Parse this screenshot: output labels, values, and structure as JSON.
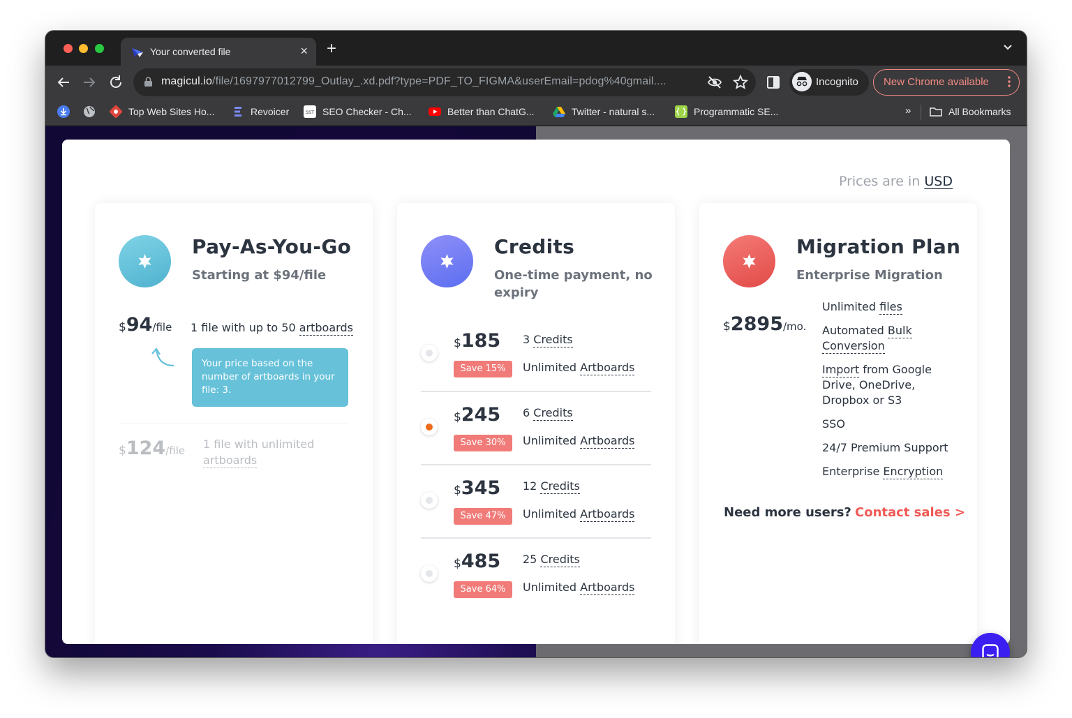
{
  "browser": {
    "tab_title": "Your converted file",
    "new_tab_label": "+",
    "url_host": "magicul.io",
    "url_path": "/file/1697977012799_Outlay_.xd.pdf?type=PDF_TO_FIGMA&userEmail=pdog%40gmail....",
    "incognito_label": "Incognito",
    "update_label": "New Chrome available",
    "bookmarks": [
      {
        "label": ""
      },
      {
        "label": ""
      },
      {
        "label": "Top Web Sites Ho..."
      },
      {
        "label": "Revoicer"
      },
      {
        "label": "SEO Checker - Ch..."
      },
      {
        "label": "Better than ChatG..."
      },
      {
        "label": "Twitter - natural s..."
      },
      {
        "label": "Programmatic SE..."
      }
    ],
    "bookmarks_overflow": "»",
    "all_bookmarks_label": "All Bookmarks"
  },
  "pricing": {
    "currency_prefix": "Prices are in",
    "currency": "USD",
    "payg": {
      "title": "Pay-As-You-Go",
      "subtitle": "Starting at $94/file",
      "options": [
        {
          "currency_symbol": "$",
          "amount": "94",
          "unit": "/file",
          "text": "1 file with up to 50",
          "link": "artboards"
        },
        {
          "currency_symbol": "$",
          "amount": "124",
          "unit": "/file",
          "text": "1 file with unlimited",
          "link": "artboards"
        }
      ],
      "tooltip": "Your price based on the number of artboards in your file: 3."
    },
    "credits": {
      "title": "Credits",
      "subtitle": "One-time payment, no expiry",
      "options": [
        {
          "currency_symbol": "$",
          "amount": "185",
          "save": "Save 15%",
          "count": "3",
          "credits_label": "Credits",
          "unlimited": "Unlimited",
          "artboards_label": "Artboards",
          "selected": false
        },
        {
          "currency_symbol": "$",
          "amount": "245",
          "save": "Save 30%",
          "count": "6",
          "credits_label": "Credits",
          "unlimited": "Unlimited",
          "artboards_label": "Artboards",
          "selected": true
        },
        {
          "currency_symbol": "$",
          "amount": "345",
          "save": "Save 47%",
          "count": "12",
          "credits_label": "Credits",
          "unlimited": "Unlimited",
          "artboards_label": "Artboards",
          "selected": false
        },
        {
          "currency_symbol": "$",
          "amount": "485",
          "save": "Save 64%",
          "count": "25",
          "credits_label": "Credits",
          "unlimited": "Unlimited",
          "artboards_label": "Artboards",
          "selected": false
        }
      ]
    },
    "migration": {
      "title": "Migration Plan",
      "subtitle": "Enterprise Migration",
      "currency_symbol": "$",
      "amount": "2895",
      "unit": "/mo.",
      "features": [
        {
          "pre": "Unlimited",
          "link": "files",
          "post": ""
        },
        {
          "pre": "Automated",
          "link": "Bulk Conversion",
          "post": ""
        },
        {
          "pre": "",
          "link": "Import",
          "post": "from Google Drive, OneDrive, Dropbox or S3"
        },
        {
          "pre": "SSO",
          "link": "",
          "post": ""
        },
        {
          "pre": "24/7 Premium Support",
          "link": "",
          "post": ""
        },
        {
          "pre": "Enterprise",
          "link": "Encryption",
          "post": ""
        }
      ],
      "more_users": "Need more users?",
      "contact": "Contact sales >"
    }
  },
  "colors": {
    "payg_accent": "#66c1d9",
    "credits_accent": "#6d7cf7",
    "migration_accent": "#ef5a56",
    "selected_radio": "#ef6a1b",
    "save_badge": "#f07b78",
    "chat_button": "#3b1ef0"
  },
  "icons": [
    "star-icon",
    "chat-icon",
    "back-arrow-icon",
    "forward-arrow-icon",
    "reload-icon",
    "lock-icon",
    "eye-off-icon",
    "bookmark-star-icon",
    "side-panel-icon",
    "incognito-icon",
    "folder-icon"
  ]
}
